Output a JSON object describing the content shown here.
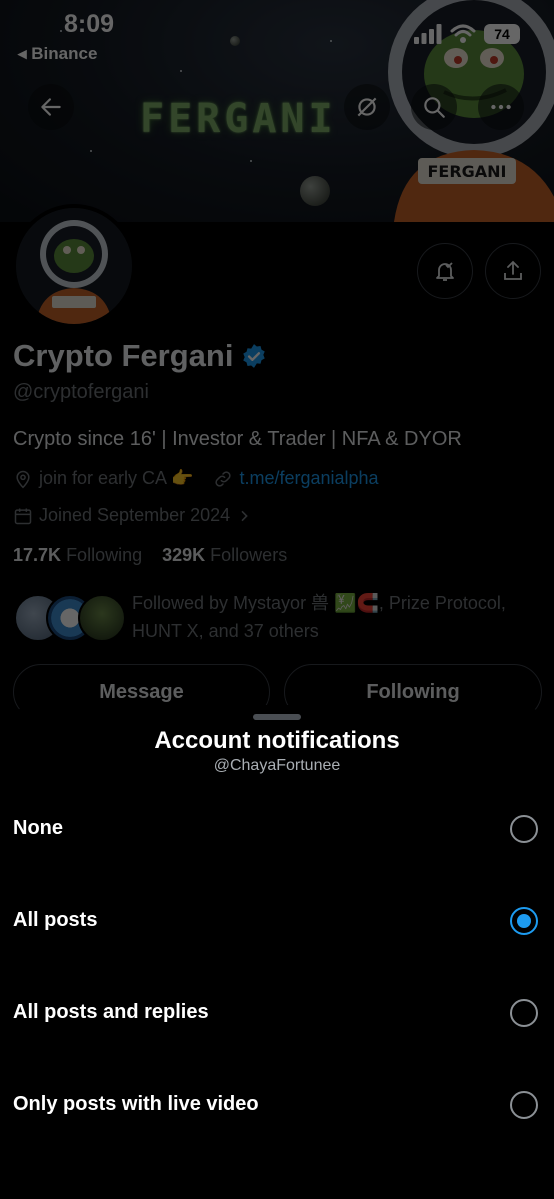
{
  "status_bar": {
    "time": "8:09",
    "back_app": "Binance",
    "battery": "74"
  },
  "banner": {
    "word": "FERGANI"
  },
  "profile": {
    "name": "Crypto Fergani",
    "handle": "@cryptofergani",
    "bio": "Crypto since 16' | Investor & Trader | NFA & DYOR",
    "location": "join for early CA 👉",
    "link": "t.me/ferganialpha",
    "joined": "Joined September 2024",
    "following_count": "17.7K",
    "following_label": "Following",
    "followers_count": "329K",
    "followers_label": "Followers",
    "followed_by": "Followed by Mystayor 兽 💹🧲, Prize Protocol, HUNT X, and 37 others",
    "message_label": "Message",
    "following_button_label": "Following"
  },
  "sheet": {
    "title": "Account notifications",
    "subtitle": "@ChayaFortunee",
    "options": [
      {
        "label": "None",
        "selected": false
      },
      {
        "label": "All posts",
        "selected": true
      },
      {
        "label": "All posts and replies",
        "selected": false
      },
      {
        "label": "Only posts with live video",
        "selected": false
      }
    ]
  },
  "colors": {
    "accent": "#1d9bf0",
    "muted": "#71767b",
    "background": "#000000"
  }
}
